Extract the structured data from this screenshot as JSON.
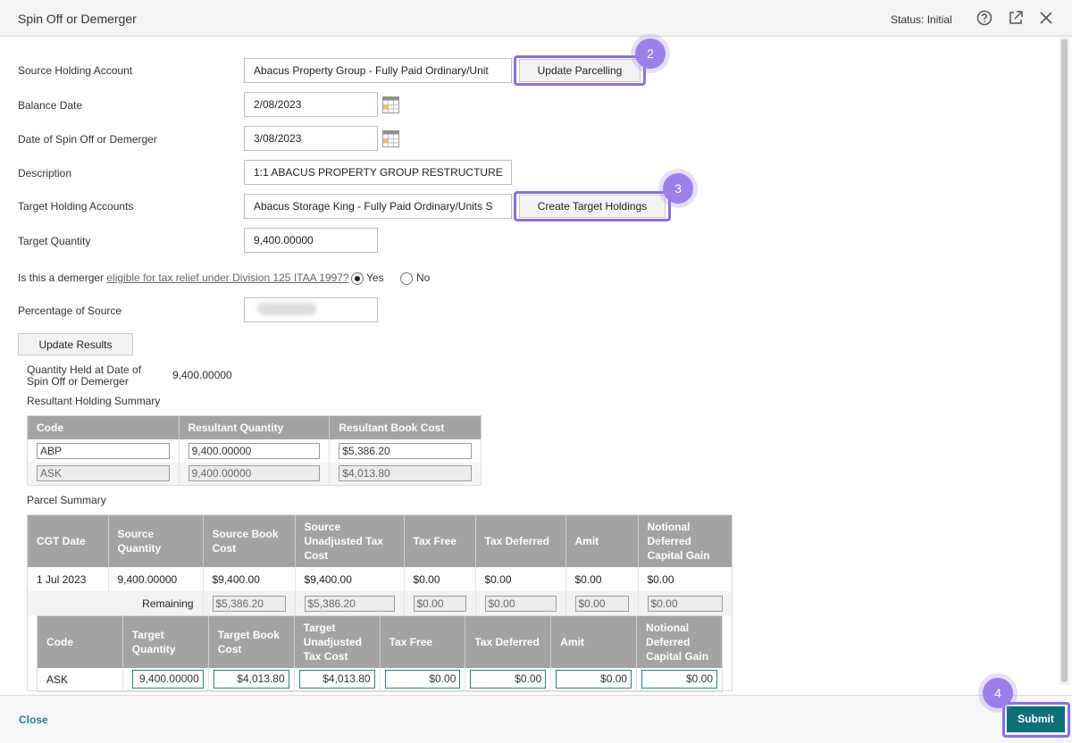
{
  "header": {
    "title": "Spin Off or Demerger",
    "status": "Status: Initial",
    "icons": [
      "help-icon",
      "popout-icon",
      "close-icon"
    ]
  },
  "form": {
    "source_holding": {
      "label": "Source Holding Account",
      "value": "Abacus Property Group - Fully Paid Ordinary/Unit"
    },
    "update_parcelling": "Update Parcelling",
    "balance_date": {
      "label": "Balance Date",
      "value": "2/08/2023"
    },
    "spin_date": {
      "label": "Date of Spin Off or Demerger",
      "value": "3/08/2023"
    },
    "description": {
      "label": "Description",
      "value": "1:1 ABACUS PROPERTY GROUP RESTRUCTURE"
    },
    "target_holdings": {
      "label": "Target Holding Accounts",
      "value": "Abacus Storage King - Fully Paid Ordinary/Units S"
    },
    "create_target": "Create Target Holdings",
    "target_quantity": {
      "label": "Target Quantity",
      "value": "9,400.00000"
    },
    "demerger_question": {
      "prefix": "Is this a demerger ",
      "link": "eligible for tax relief under Division 125 ITAA 1997?",
      "yes": "Yes",
      "no": "No",
      "selected": "Yes"
    },
    "percentage": {
      "label": "Percentage of Source",
      "value": ""
    },
    "update_results": "Update Results"
  },
  "steps": [
    "2",
    "3",
    "4"
  ],
  "quantity_held": {
    "label_line1": "Quantity Held at Date of",
    "label_line2": "Spin Off or Demerger",
    "value": "9,400.00000"
  },
  "resultant": {
    "title": "Resultant Holding Summary",
    "headers": [
      "Code",
      "Resultant Quantity",
      "Resultant Book Cost"
    ],
    "rows": [
      {
        "code": "ABP",
        "qty": "9,400.00000",
        "cost": "$5,386.20",
        "readonly": false
      },
      {
        "code": "ASK",
        "qty": "9,400.00000",
        "cost": "$4,013.80",
        "readonly": true
      }
    ]
  },
  "parcel": {
    "title": "Parcel Summary",
    "headers": [
      "CGT Date",
      "Source Quantity",
      "Source Book Cost",
      "Source Unadjusted Tax Cost",
      "Tax Free",
      "Tax Deferred",
      "Amit",
      "Notional Deferred Capital Gain"
    ],
    "row": [
      "1 Jul 2023",
      "9,400.00000",
      "$9,400.00",
      "$9,400.00",
      "$0.00",
      "$0.00",
      "$0.00",
      "$0.00"
    ],
    "remaining_label": "Remaining",
    "remaining": [
      "$5,386.20",
      "$5,386.20",
      "$0.00",
      "$0.00",
      "$0.00",
      "$0.00"
    ],
    "target_headers": [
      "Code",
      "Target Quantity",
      "Target Book Cost",
      "Target Unadjusted Tax Cost",
      "Tax Free",
      "Tax Deferred",
      "Amit",
      "Notional Deferred Capital Gain"
    ],
    "target_row": {
      "code": "ASK",
      "values": [
        "9,400.00000",
        "$4,013.80",
        "$4,013.80",
        "$0.00",
        "$0.00",
        "$0.00",
        "$0.00"
      ]
    }
  },
  "footer": {
    "close": "Close",
    "submit": "Submit"
  },
  "colors": {
    "accent": "#0d6f78",
    "highlight": "#8a6fe0",
    "table_header": "#a3a3a3"
  }
}
